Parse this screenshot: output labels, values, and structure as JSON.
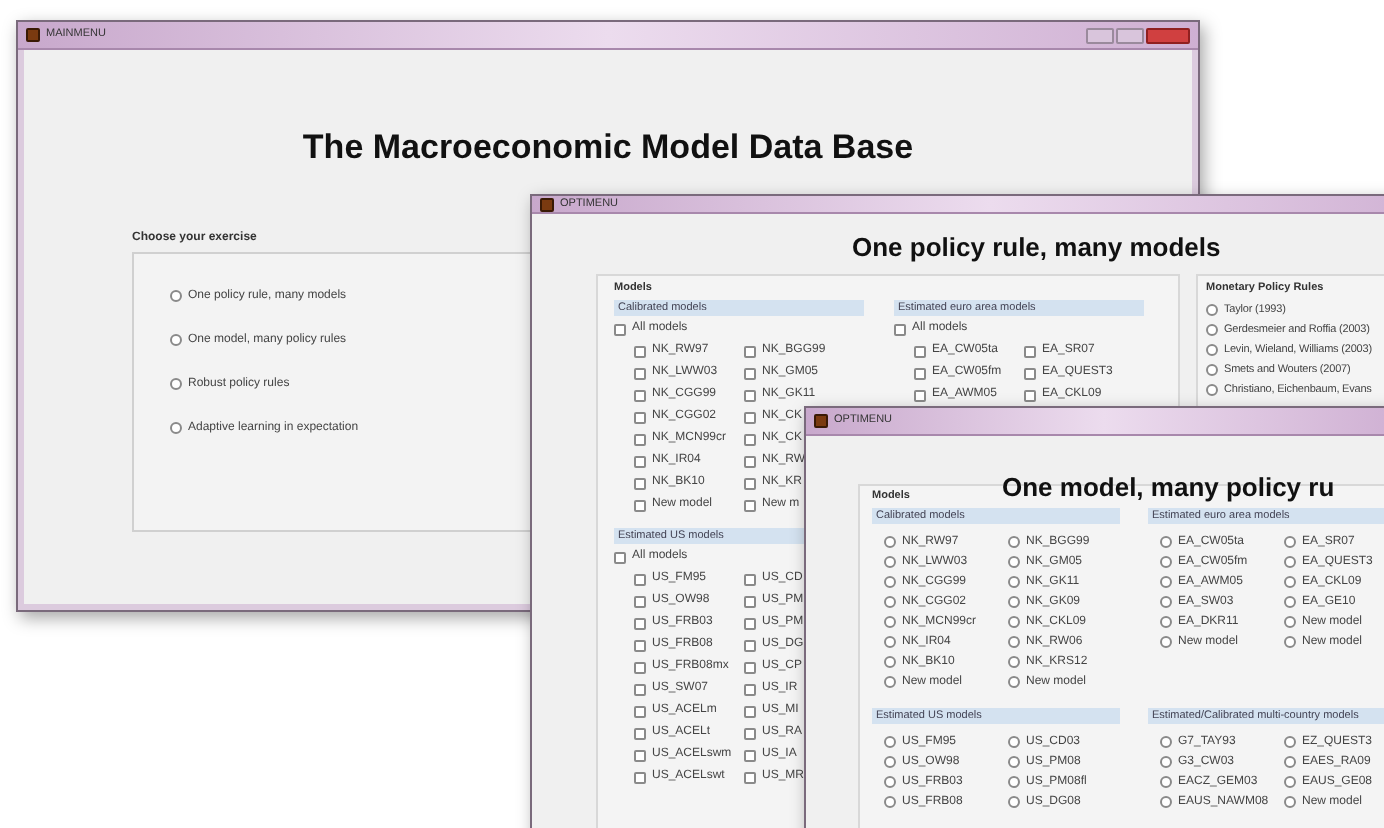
{
  "windows": [
    {
      "kind": "main",
      "title": "MAINMENU",
      "heading": "The Macroeconomic Model Data Base",
      "panel": {
        "label": "Choose your exercise",
        "options": [
          {
            "label": "One policy rule, many models",
            "selected": false
          },
          {
            "label": "One model, many policy rules",
            "selected": false
          },
          {
            "label": "Robust policy rules",
            "selected": false
          },
          {
            "label": "Adaptive learning in expectation",
            "selected": false
          }
        ]
      }
    },
    {
      "kind": "checkbox_menu",
      "title": "OPTIMENU",
      "heading": "One policy rule, many models",
      "models_label": "Models",
      "groups": [
        {
          "title": "Calibrated models",
          "all": {
            "label": "All models",
            "checked": false
          },
          "columns": [
            [
              {
                "label": "NK_RW97",
                "checked": false
              },
              {
                "label": "NK_LWW03",
                "checked": false
              },
              {
                "label": "NK_CGG99",
                "checked": false
              },
              {
                "label": "NK_CGG02",
                "checked": false
              },
              {
                "label": "NK_MCN99cr",
                "checked": false
              },
              {
                "label": "NK_IR04",
                "checked": false
              },
              {
                "label": "NK_BK10",
                "checked": false
              },
              {
                "label": "New model",
                "checked": false
              }
            ],
            [
              {
                "label": "NK_BGG99",
                "checked": false
              },
              {
                "label": "NK_GM05",
                "checked": false
              },
              {
                "label": "NK_GK11",
                "checked": false
              },
              {
                "label": "NK_CK",
                "checked": false
              },
              {
                "label": "NK_CK",
                "checked": false
              },
              {
                "label": "NK_RW",
                "checked": false
              },
              {
                "label": "NK_KR",
                "checked": false
              },
              {
                "label": "New m",
                "checked": false
              }
            ]
          ]
        },
        {
          "title": "Estimated euro area models",
          "all": {
            "label": "All models",
            "checked": false
          },
          "columns": [
            [
              {
                "label": "EA_CW05ta",
                "checked": false
              },
              {
                "label": "EA_CW05fm",
                "checked": false
              },
              {
                "label": "EA_AWM05",
                "checked": false
              }
            ],
            [
              {
                "label": "EA_SR07",
                "checked": false
              },
              {
                "label": "EA_QUEST3",
                "checked": false
              },
              {
                "label": "EA_CKL09",
                "checked": false
              }
            ]
          ]
        },
        {
          "title": "Estimated US models",
          "all": {
            "label": "All models",
            "checked": false
          },
          "columns": [
            [
              {
                "label": "US_FM95",
                "checked": false
              },
              {
                "label": "US_OW98",
                "checked": false
              },
              {
                "label": "US_FRB03",
                "checked": false
              },
              {
                "label": "US_FRB08",
                "checked": false
              },
              {
                "label": "US_FRB08mx",
                "checked": false
              },
              {
                "label": "US_SW07",
                "checked": false
              },
              {
                "label": "US_ACELm",
                "checked": false
              },
              {
                "label": "US_ACELt",
                "checked": false
              },
              {
                "label": "US_ACELswm",
                "checked": false
              },
              {
                "label": "US_ACELswt",
                "checked": false
              }
            ],
            [
              {
                "label": "US_CD",
                "checked": false
              },
              {
                "label": "US_PM",
                "checked": false
              },
              {
                "label": "US_PM",
                "checked": false
              },
              {
                "label": "US_DG",
                "checked": false
              },
              {
                "label": "US_CP",
                "checked": false
              },
              {
                "label": "US_IR",
                "checked": false
              },
              {
                "label": "US_MI",
                "checked": false
              },
              {
                "label": "US_RA",
                "checked": false
              },
              {
                "label": "US_IA",
                "checked": false
              },
              {
                "label": "US_MR",
                "checked": false
              }
            ]
          ]
        }
      ],
      "rules": {
        "label": "Monetary Policy Rules",
        "options": [
          {
            "label": "Taylor (1993)",
            "selected": false
          },
          {
            "label": "Gerdesmeier and Roffia (2003)",
            "selected": false
          },
          {
            "label": "Levin, Wieland, Williams (2003)",
            "selected": false
          },
          {
            "label": "Smets and Wouters (2007)",
            "selected": false
          },
          {
            "label": "Christiano, Eichenbaum, Evans",
            "selected": false
          }
        ]
      }
    },
    {
      "kind": "radio_menu",
      "title": "OPTIMENU",
      "heading": "One model, many policy ru",
      "models_label": "Models",
      "groups": [
        {
          "title": "Calibrated models",
          "columns": [
            [
              {
                "label": "NK_RW97",
                "selected": false
              },
              {
                "label": "NK_LWW03",
                "selected": false
              },
              {
                "label": "NK_CGG99",
                "selected": false
              },
              {
                "label": "NK_CGG02",
                "selected": false
              },
              {
                "label": "NK_MCN99cr",
                "selected": false
              },
              {
                "label": "NK_IR04",
                "selected": false
              },
              {
                "label": "NK_BK10",
                "selected": false
              },
              {
                "label": "New model",
                "selected": false
              }
            ],
            [
              {
                "label": "NK_BGG99",
                "selected": false
              },
              {
                "label": "NK_GM05",
                "selected": false
              },
              {
                "label": "NK_GK11",
                "selected": false
              },
              {
                "label": "NK_GK09",
                "selected": false
              },
              {
                "label": "NK_CKL09",
                "selected": false
              },
              {
                "label": "NK_RW06",
                "selected": false
              },
              {
                "label": "NK_KRS12",
                "selected": false
              },
              {
                "label": "New model",
                "selected": false
              }
            ]
          ]
        },
        {
          "title": "Estimated euro area models",
          "columns": [
            [
              {
                "label": "EA_CW05ta",
                "selected": false
              },
              {
                "label": "EA_CW05fm",
                "selected": false
              },
              {
                "label": "EA_AWM05",
                "selected": false
              },
              {
                "label": "EA_SW03",
                "selected": false
              },
              {
                "label": "EA_DKR11",
                "selected": false
              },
              {
                "label": "New model",
                "selected": false
              }
            ],
            [
              {
                "label": "EA_SR07",
                "selected": false
              },
              {
                "label": "EA_QUEST3",
                "selected": false
              },
              {
                "label": "EA_CKL09",
                "selected": false
              },
              {
                "label": "EA_GE10",
                "selected": false
              },
              {
                "label": "New model",
                "selected": false
              },
              {
                "label": "New model",
                "selected": false
              }
            ]
          ]
        },
        {
          "title": "Estimated US models",
          "columns": [
            [
              {
                "label": "US_FM95",
                "selected": false
              },
              {
                "label": "US_OW98",
                "selected": false
              },
              {
                "label": "US_FRB03",
                "selected": false
              },
              {
                "label": "US_FRB08",
                "selected": false
              }
            ],
            [
              {
                "label": "US_CD03",
                "selected": false
              },
              {
                "label": "US_PM08",
                "selected": false
              },
              {
                "label": "US_PM08fl",
                "selected": false
              },
              {
                "label": "US_DG08",
                "selected": false
              }
            ]
          ]
        },
        {
          "title": "Estimated/Calibrated multi-country models",
          "columns": [
            [
              {
                "label": "G7_TAY93",
                "selected": false
              },
              {
                "label": "G3_CW03",
                "selected": false
              },
              {
                "label": "EACZ_GEM03",
                "selected": false
              },
              {
                "label": "EAUS_NAWM08",
                "selected": false
              }
            ],
            [
              {
                "label": "EZ_QUEST3",
                "selected": false
              },
              {
                "label": "EAES_RA09",
                "selected": false
              },
              {
                "label": "EAUS_GE08",
                "selected": false
              },
              {
                "label": "New model",
                "selected": false
              }
            ]
          ]
        }
      ]
    }
  ]
}
